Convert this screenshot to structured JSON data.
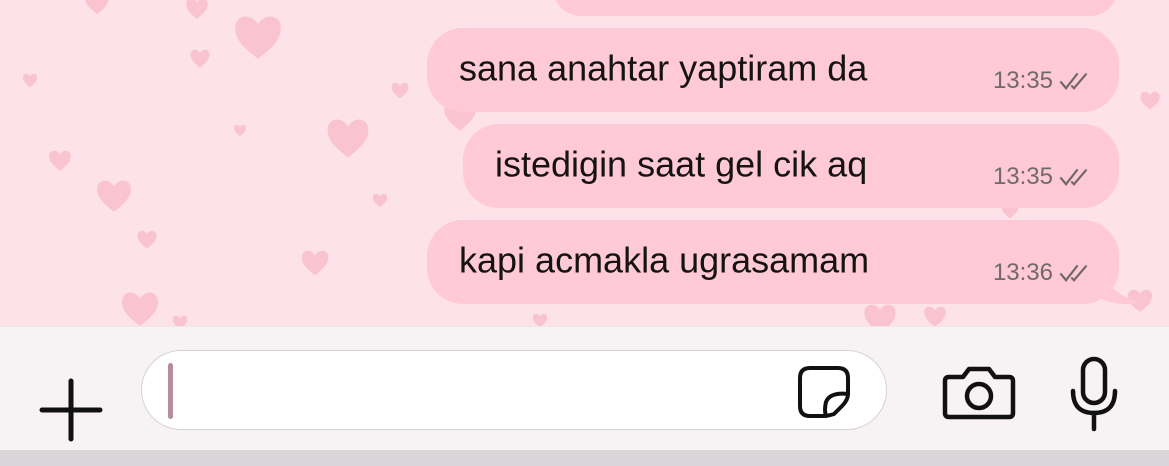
{
  "messages": [
    {
      "text": "sana anahtar yaptiram da",
      "time": "13:35",
      "status": "read-double-check"
    },
    {
      "text": "istedigin saat gel cik aq",
      "time": "13:35",
      "status": "read-double-check"
    },
    {
      "text": "kapi acmakla ugrasamam",
      "time": "13:36",
      "status": "read-double-check"
    }
  ],
  "composer": {
    "value": "",
    "icons": {
      "attach": "plus-icon",
      "sticker": "sticker-icon",
      "camera": "camera-icon",
      "voice": "microphone-icon"
    }
  },
  "colors": {
    "chat_background": "#fde3e9",
    "outgoing_bubble": "#ffc9d6",
    "heart_pattern": "#f9b3c3",
    "input_bar": "#f7f3f4"
  }
}
